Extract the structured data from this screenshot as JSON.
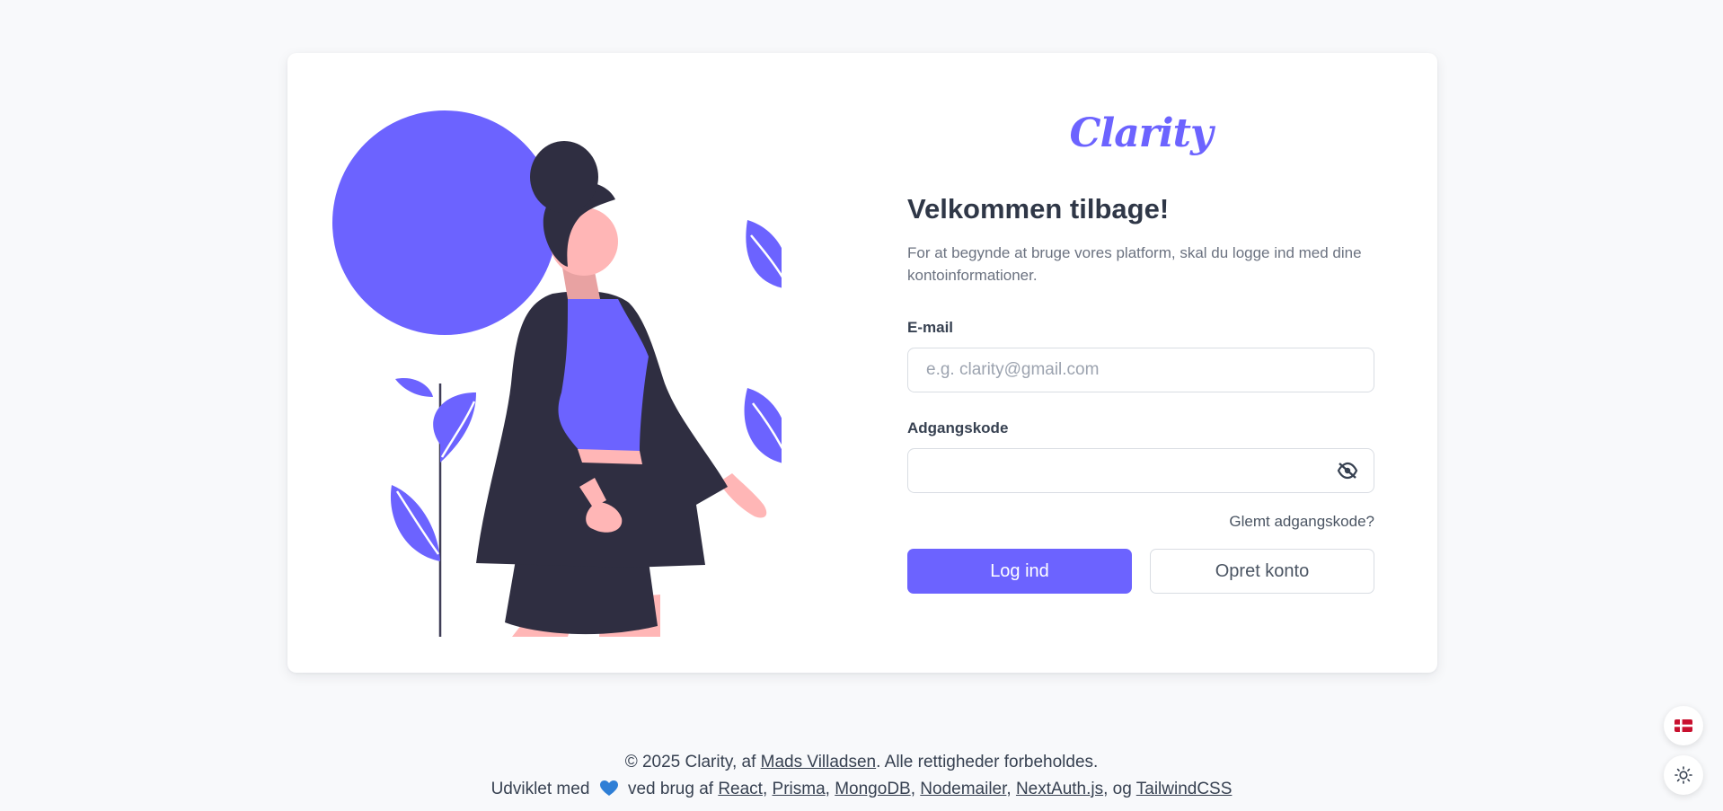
{
  "brand": {
    "name": "Clarity",
    "accent": "#6c63ff"
  },
  "login": {
    "title": "Velkommen tilbage!",
    "subtitle": "For at begynde at bruge vores platform, skal du logge ind med dine kontoinformationer.",
    "email_label": "E-mail",
    "email_placeholder": "e.g. clarity@gmail.com",
    "email_value": "",
    "password_label": "Adgangskode",
    "password_value": "",
    "password_toggle_icon": "eye-off-icon",
    "forgot_label": "Glemt adgangskode?",
    "login_button": "Log ind",
    "signup_button": "Opret konto"
  },
  "footer": {
    "line1_prefix": "© 2025 Clarity, af",
    "author": "Mads Villadsen",
    "line1_suffix": ". Alle rettigheder forbeholdes.",
    "line2_prefix": "Udviklet med",
    "line2_middle": "ved brug af",
    "tech": [
      "React",
      "Prisma",
      "MongoDB",
      "Nodemailer",
      "NextAuth.js",
      "TailwindCSS"
    ],
    "and_word": "og"
  },
  "floating": {
    "language_icon": "danish-flag-icon",
    "theme_icon": "sun-icon"
  }
}
